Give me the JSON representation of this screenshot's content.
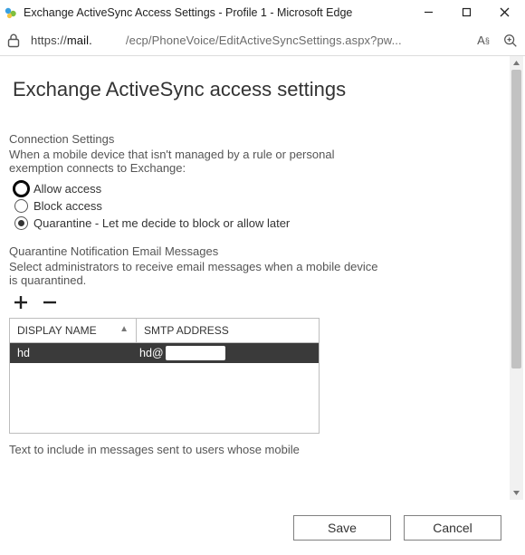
{
  "window": {
    "title": "Exchange ActiveSync Access Settings - Profile 1 - Microsoft Edge"
  },
  "address": {
    "scheme": "https://",
    "host": "mail.",
    "rest": "/ecp/PhoneVoice/EditActiveSyncSettings.aspx?pw..."
  },
  "page": {
    "title": "Exchange ActiveSync access settings",
    "connection": {
      "label": "Connection Settings",
      "help": "When a mobile device that isn't managed by a rule or personal exemption connects to Exchange:",
      "options": [
        {
          "key": "allow",
          "label": "Allow access",
          "selected": false,
          "focused": true
        },
        {
          "key": "block",
          "label": "Block access",
          "selected": false,
          "focused": false
        },
        {
          "key": "quarantine",
          "label": "Quarantine - Let me decide to block or allow later",
          "selected": true,
          "focused": false
        }
      ]
    },
    "quarantine": {
      "label": "Quarantine Notification Email Messages",
      "help": "Select administrators to receive email messages when a mobile device is quarantined."
    },
    "admins_table": {
      "columns": [
        "DISPLAY NAME",
        "SMTP ADDRESS"
      ],
      "rows": [
        {
          "display_name": "hd",
          "smtp_prefix": "hd@"
        }
      ]
    },
    "footer_note": "Text to include in messages sent to users whose mobile",
    "buttons": {
      "save": "Save",
      "cancel": "Cancel"
    }
  }
}
